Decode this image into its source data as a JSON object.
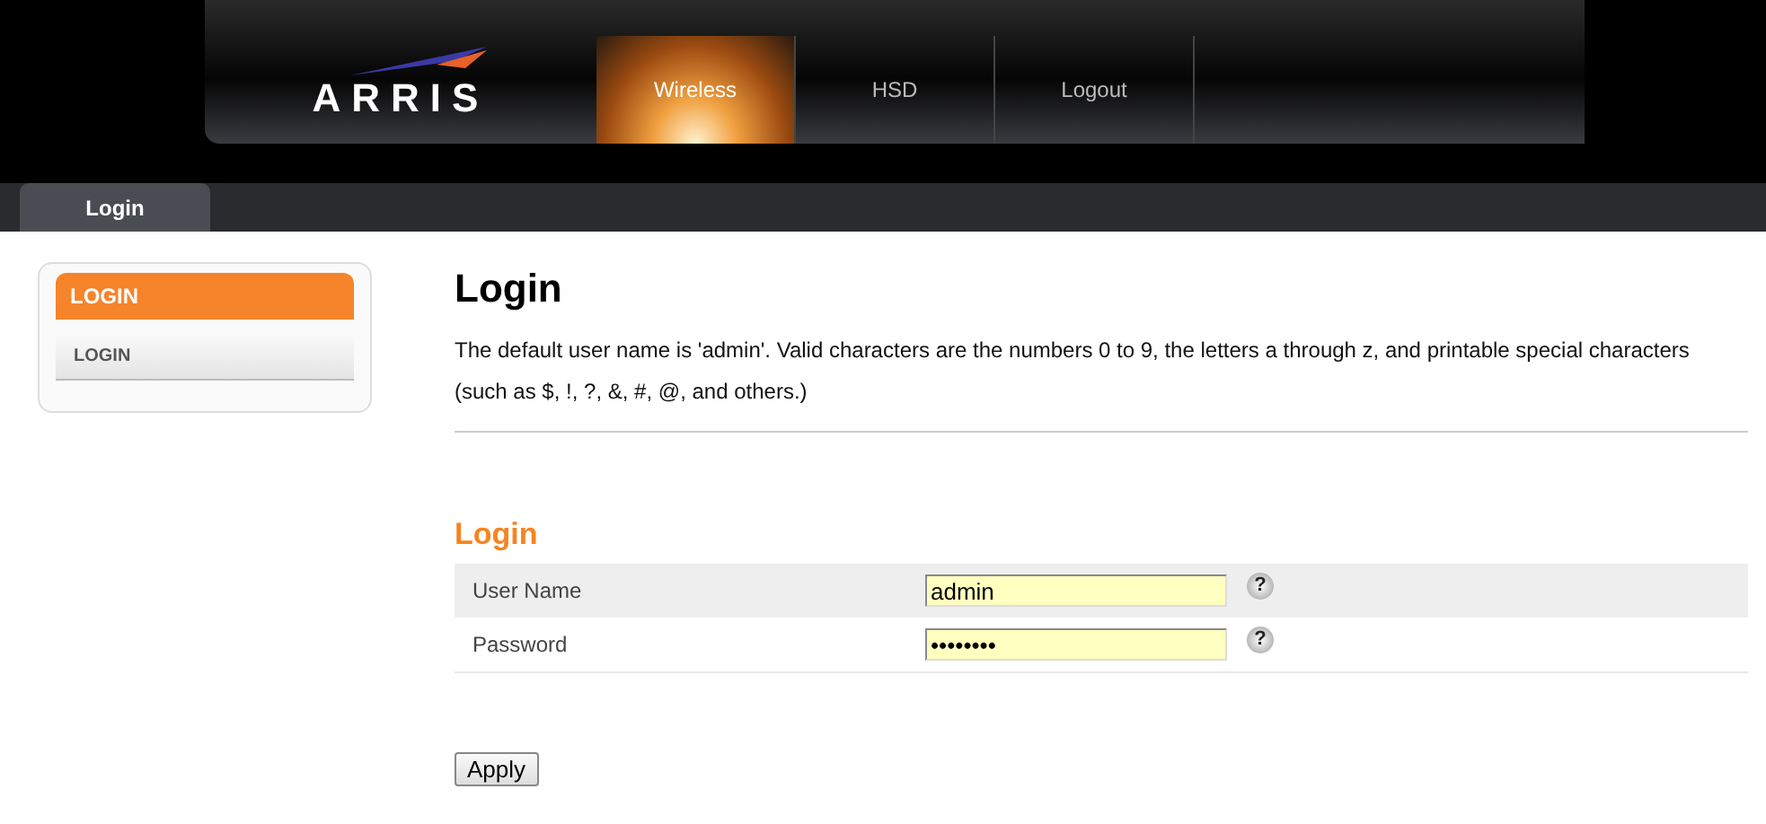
{
  "header": {
    "logo": "ARRIS",
    "nav": [
      {
        "label": "Wireless",
        "selected": true
      },
      {
        "label": "HSD",
        "selected": false
      },
      {
        "label": "Logout",
        "selected": false
      }
    ]
  },
  "tabs": [
    {
      "label": "Login",
      "selected": true
    }
  ],
  "sidebar": {
    "heading": "LOGIN",
    "items": [
      {
        "label": "LOGIN"
      }
    ]
  },
  "main": {
    "title": "Login",
    "description": "The default user name is 'admin'. Valid characters are the numbers 0 to 9, the letters a through z, and printable special characters (such as $, !, ?, &, #, @, and others.)",
    "section_title": "Login",
    "fields": [
      {
        "label": "User Name",
        "value": "admin",
        "help": "?"
      },
      {
        "label": "Password",
        "value": "••••••••",
        "help": "?"
      }
    ],
    "button": "Apply"
  }
}
